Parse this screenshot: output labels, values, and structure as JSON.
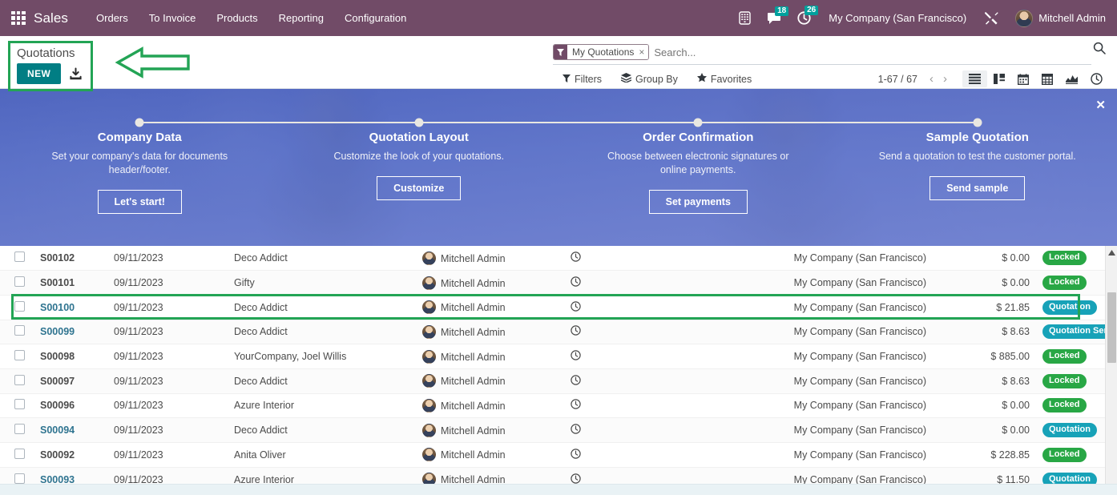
{
  "navbar": {
    "apps_icon": "apps-grid-icon",
    "brand": "Sales",
    "menu": [
      "Orders",
      "To Invoice",
      "Products",
      "Reporting",
      "Configuration"
    ],
    "systray": {
      "voip_icon": "phone-dialpad-icon",
      "messages_icon": "chat-bubble-icon",
      "messages_count": "18",
      "activities_icon": "clock-icon",
      "activities_count": "26",
      "company": "My Company (San Francisco)",
      "tools_icon": "wrench-screwdriver-icon",
      "avatar_icon": "user-avatar",
      "user": "Mitchell Admin"
    }
  },
  "control_panel": {
    "breadcrumb": "Quotations",
    "new_label": "NEW",
    "import_icon": "import-download-icon",
    "annotation_arrow_icon": "left-arrow-annotation",
    "search": {
      "facet_icon": "filter-funnel-icon",
      "facet_label": "My Quotations",
      "facet_remove_icon": "close-x-icon",
      "placeholder": "Search...",
      "value": "",
      "search_icon": "magnifier-icon"
    },
    "buttons": [
      {
        "label": "Filters",
        "icon": "filter-funnel-icon"
      },
      {
        "label": "Group By",
        "icon": "layers-icon"
      },
      {
        "label": "Favorites",
        "icon": "star-icon"
      }
    ],
    "pager": {
      "text": "1-67 / 67",
      "prev_icon": "chevron-left-icon",
      "next_icon": "chevron-right-icon"
    },
    "views": [
      {
        "name": "list",
        "icon": "list-view-icon",
        "active": true
      },
      {
        "name": "kanban",
        "icon": "kanban-view-icon",
        "active": false
      },
      {
        "name": "calendar",
        "icon": "calendar-view-icon",
        "active": false
      },
      {
        "name": "pivot",
        "icon": "pivot-view-icon",
        "active": false
      },
      {
        "name": "graph",
        "icon": "graph-view-icon",
        "active": false
      },
      {
        "name": "activity",
        "icon": "activity-clock-view-icon",
        "active": false
      }
    ]
  },
  "banner": {
    "close_icon": "close-x-icon",
    "steps": [
      {
        "title": "Company Data",
        "desc": "Set your company's data for documents header/footer.",
        "button": "Let's start!"
      },
      {
        "title": "Quotation Layout",
        "desc": "Customize the look of your quotations.",
        "button": "Customize"
      },
      {
        "title": "Order Confirmation",
        "desc": "Choose between electronic signatures or online payments.",
        "button": "Set payments"
      },
      {
        "title": "Sample Quotation",
        "desc": "Send a quotation to test the customer portal.",
        "button": "Send sample"
      }
    ]
  },
  "list": {
    "checkbox_icon": "checkbox-icon",
    "activity_icon": "clock-icon",
    "avatar_icon": "user-avatar",
    "rows": [
      {
        "number": "S00102",
        "date": "09/11/2023",
        "customer": "Deco Addict",
        "salesperson": "Mitchell Admin",
        "company": "My Company (San Francisco)",
        "total": "$ 0.00",
        "status": "Locked",
        "status_color": "green",
        "unread": false
      },
      {
        "number": "S00101",
        "date": "09/11/2023",
        "customer": "Gifty",
        "salesperson": "Mitchell Admin",
        "company": "My Company (San Francisco)",
        "total": "$ 0.00",
        "status": "Locked",
        "status_color": "green",
        "unread": false
      },
      {
        "number": "S00100",
        "date": "09/11/2023",
        "customer": "Deco Addict",
        "salesperson": "Mitchell Admin",
        "company": "My Company (San Francisco)",
        "total": "$ 21.85",
        "status": "Quotation",
        "status_color": "teal",
        "unread": true
      },
      {
        "number": "S00099",
        "date": "09/11/2023",
        "customer": "Deco Addict",
        "salesperson": "Mitchell Admin",
        "company": "My Company (San Francisco)",
        "total": "$ 8.63",
        "status": "Quotation Sent",
        "status_color": "teal",
        "unread": true
      },
      {
        "number": "S00098",
        "date": "09/11/2023",
        "customer": "YourCompany, Joel Willis",
        "salesperson": "Mitchell Admin",
        "company": "My Company (San Francisco)",
        "total": "$ 885.00",
        "status": "Locked",
        "status_color": "green",
        "unread": false
      },
      {
        "number": "S00097",
        "date": "09/11/2023",
        "customer": "Deco Addict",
        "salesperson": "Mitchell Admin",
        "company": "My Company (San Francisco)",
        "total": "$ 8.63",
        "status": "Locked",
        "status_color": "green",
        "unread": false
      },
      {
        "number": "S00096",
        "date": "09/11/2023",
        "customer": "Azure Interior",
        "salesperson": "Mitchell Admin",
        "company": "My Company (San Francisco)",
        "total": "$ 0.00",
        "status": "Locked",
        "status_color": "green",
        "unread": false
      },
      {
        "number": "S00094",
        "date": "09/11/2023",
        "customer": "Deco Addict",
        "salesperson": "Mitchell Admin",
        "company": "My Company (San Francisco)",
        "total": "$ 0.00",
        "status": "Quotation",
        "status_color": "teal",
        "unread": true
      },
      {
        "number": "S00092",
        "date": "09/11/2023",
        "customer": "Anita Oliver",
        "salesperson": "Mitchell Admin",
        "company": "My Company (San Francisco)",
        "total": "$ 228.85",
        "status": "Locked",
        "status_color": "green",
        "unread": false
      },
      {
        "number": "S00093",
        "date": "09/11/2023",
        "customer": "Azure Interior",
        "salesperson": "Mitchell Admin",
        "company": "My Company (San Francisco)",
        "total": "$ 11.50",
        "status": "Quotation",
        "status_color": "teal",
        "unread": true
      }
    ],
    "highlighted_row_number": "S00100"
  },
  "colors": {
    "navbar": "#714B67",
    "accent_teal": "#017E84",
    "badge_counter": "#00A09D",
    "status_locked": "#28a745",
    "status_quotation": "#17a2b8",
    "annotation_green": "#23a455",
    "banner_blue": "#5e74c9"
  }
}
